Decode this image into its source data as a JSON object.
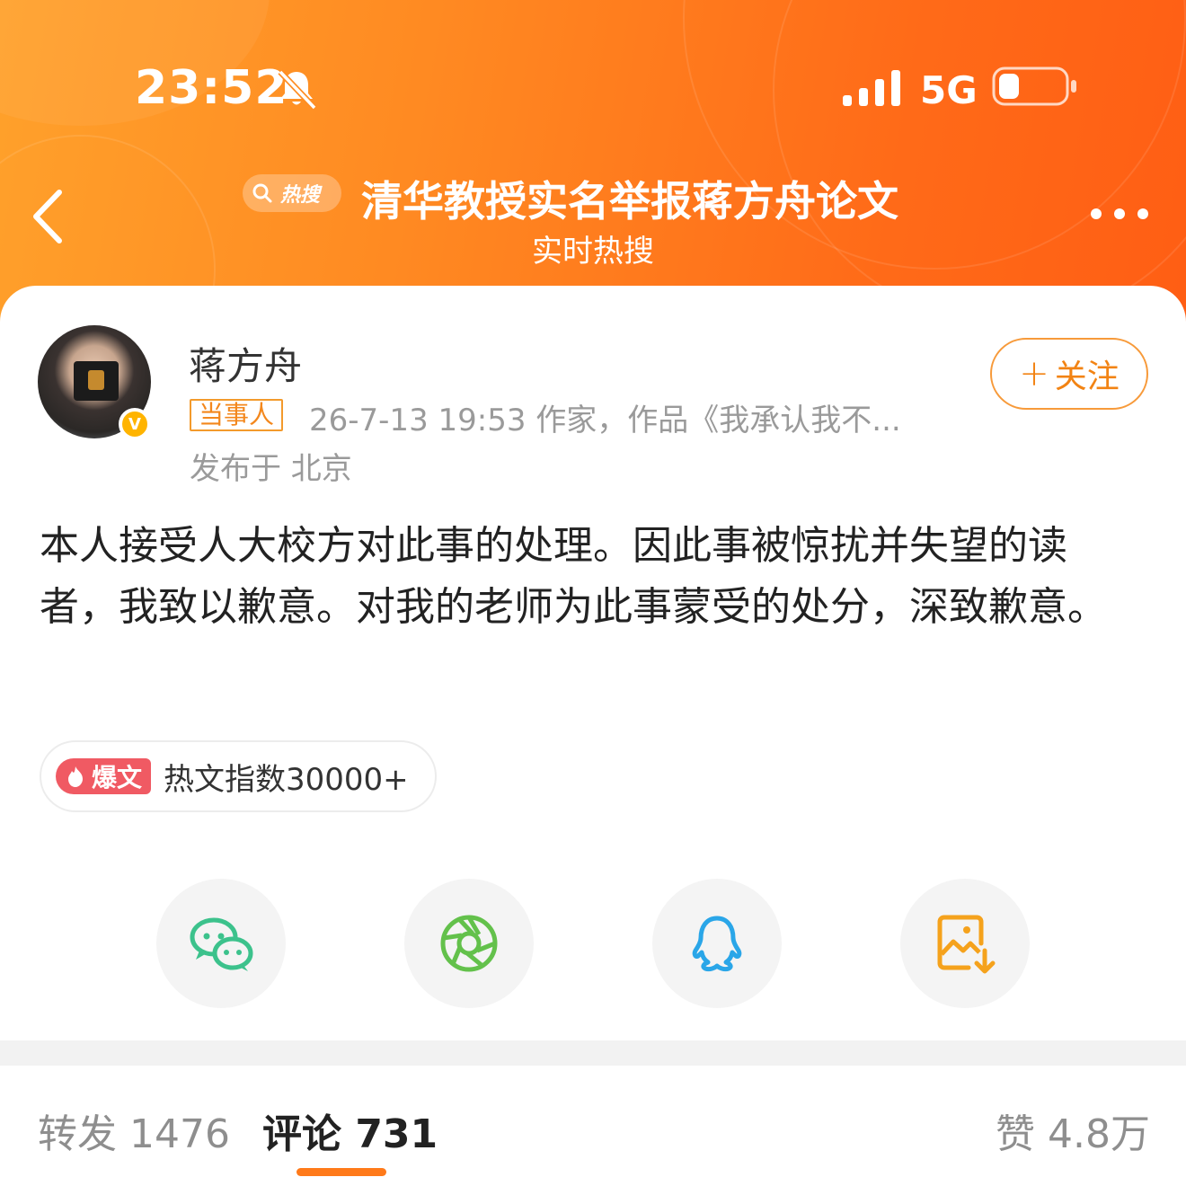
{
  "status_bar": {
    "time": "23:52",
    "network": "5G",
    "icons": [
      "bell-muted-icon",
      "signal-icon",
      "battery-icon"
    ]
  },
  "topbar": {
    "badge_label": "热搜",
    "title": "清华教授实名举报蒋方舟论文",
    "subtitle": "实时热搜",
    "icons": [
      "back-icon",
      "more-icon",
      "search-icon"
    ]
  },
  "post": {
    "author": "蒋方舟",
    "tag": "当事人",
    "meta": "26-7-13 19:53  作家，作品《我承认我不...",
    "location": "发布于 北京",
    "follow_label": "关注",
    "text": "本人接受人大校方对此事的处理。因此事被惊扰并失望的读者，我致以歉意。对我的老师为此事蒙受的处分，深致歉意。",
    "verified_mark": "V"
  },
  "hot_index": {
    "badge": "爆文",
    "label": "热文指数30000+"
  },
  "share": {
    "items": [
      "wechat-icon",
      "moments-icon",
      "qq-icon",
      "save-image-icon"
    ]
  },
  "tabs": {
    "repost": "转发 1476",
    "comment": "评论 731",
    "like": "赞 4.8万"
  },
  "colors": {
    "header_gradient_start": "#ffa12b",
    "header_gradient_end": "#ff5e14",
    "accent": "#ff7a1a",
    "follow": "#f28313",
    "burst": "#f05a63",
    "wechat": "#3cc28c",
    "moments": "#63c14b",
    "qq": "#2aa6e8",
    "save": "#f5a21c"
  }
}
